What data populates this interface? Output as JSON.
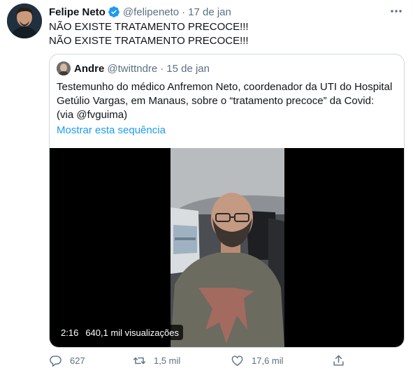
{
  "tweet": {
    "author_name": "Felipe Neto",
    "handle": "@felipeneto",
    "separator": "·",
    "date": "17 de jan",
    "lines": [
      "NÃO EXISTE TRATAMENTO PRECOCE!!!",
      "NÃO EXISTE TRATAMENTO PRECOCE!!!"
    ]
  },
  "quoted": {
    "author_name": "Andre",
    "handle": "@twittndre",
    "separator": "·",
    "date": "15 de jan",
    "text_lines": [
      "Testemunho do médico Anfremon Neto, coordenador da UTI do Hospital",
      "Getúlio Vargas, em Manaus, sobre o “tratamento precoce” da Covid:",
      "(via @fvguima)"
    ],
    "show_thread": "Mostrar esta sequência",
    "video": {
      "duration": "2:16",
      "views": "640,1 mil visualizações"
    }
  },
  "actions": {
    "replies": "627",
    "retweets": "1,5 mil",
    "likes": "17,6 mil"
  },
  "colors": {
    "accent": "#1d9bf0",
    "muted": "#5b7083",
    "border": "#cfd9de"
  },
  "icons": [
    "verified-badge-icon",
    "more-options-icon",
    "reply-icon",
    "retweet-icon",
    "like-icon",
    "share-icon"
  ]
}
